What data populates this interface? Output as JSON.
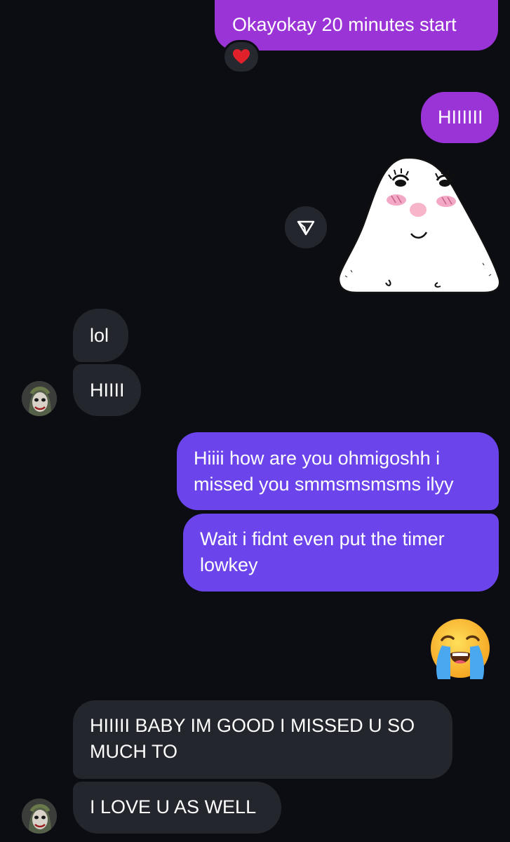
{
  "messages": [
    {
      "id": "m1",
      "direction": "outgoing",
      "text": "Okayokay 20 minutes start"
    },
    {
      "id": "m2",
      "direction": "outgoing",
      "text": "HIIIIII"
    },
    {
      "id": "m3",
      "direction": "incoming",
      "text": "lol"
    },
    {
      "id": "m4",
      "direction": "incoming",
      "text": "HIIII"
    },
    {
      "id": "m5",
      "direction": "outgoing",
      "text": "Hiiii how are you ohmigoshh i\nmissed you smmsmsmsms ilyy"
    },
    {
      "id": "m6",
      "direction": "outgoing",
      "text": "Wait i fidnt even put the timer\nlowkey"
    },
    {
      "id": "m7",
      "direction": "incoming",
      "text": "HIIIII BABY IM GOOD I MISSED U SO\nMUCH TO"
    },
    {
      "id": "m8",
      "direction": "incoming",
      "text": "I LOVE U AS WELL"
    }
  ],
  "reaction": {
    "emoji": "❤️"
  },
  "sticker": {
    "icon": "onigiri-blush-sticker"
  },
  "emoji_message": {
    "icon": "loudly-crying-face-emoji"
  },
  "colors": {
    "background": "#0b0d12",
    "outgoing_purple": "#9b34d6",
    "outgoing_violet": "#6b44ec",
    "incoming": "#23262d"
  }
}
